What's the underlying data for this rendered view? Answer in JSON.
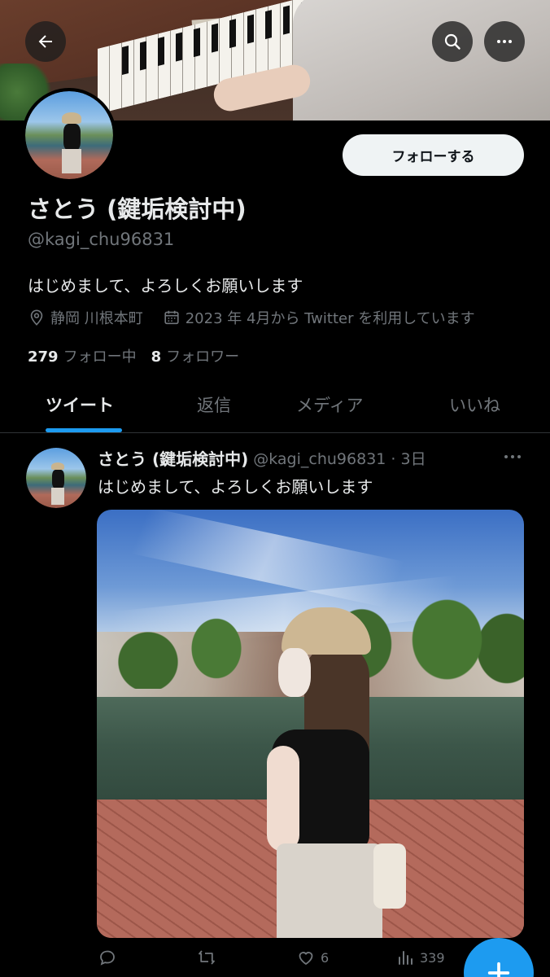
{
  "header": {
    "back_icon": "arrow-left-icon",
    "search_icon": "search-icon",
    "more_icon": "more-horizontal-icon"
  },
  "profile": {
    "name": "さとう (鍵垢検討中)",
    "handle": "@kagi_chu96831",
    "follow_label": "フォローする",
    "bio": "はじめまして、よろしくお願いします",
    "location": "静岡 川根本町",
    "joined": "2023 年 4月から Twitter を利用しています",
    "following_count": "279",
    "following_label": "フォロー中",
    "followers_count": "8",
    "followers_label": "フォロワー"
  },
  "tabs": [
    {
      "label": "ツイート",
      "active": true
    },
    {
      "label": "返信",
      "active": false
    },
    {
      "label": "メディア",
      "active": false
    },
    {
      "label": "いいね",
      "active": false
    }
  ],
  "tweet": {
    "name": "さとう (鍵垢検討中)",
    "handle_time": "@kagi_chu96831 · 3日",
    "text": "はじめまして、よろしくお願いします",
    "likes": "6",
    "views": "339"
  },
  "colors": {
    "accent": "#1d9bf0",
    "background": "#000000",
    "muted_text": "#71767b"
  }
}
